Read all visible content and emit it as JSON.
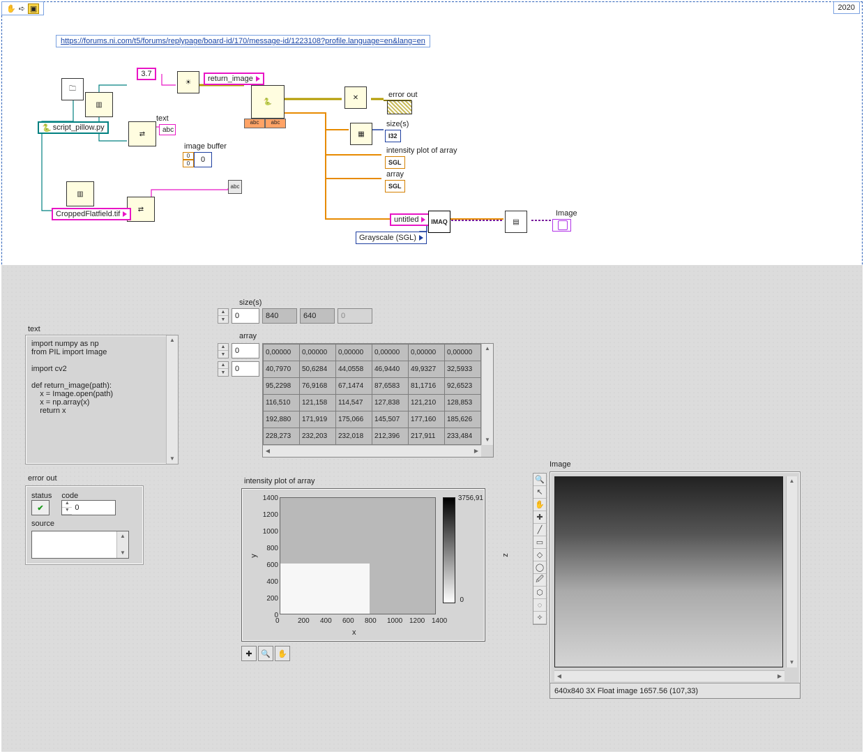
{
  "meta": {
    "year": "2020"
  },
  "link": "https://forums.ni.com/t5/forums/replypage/board-id/170/message-id/1223108?profile.language=en&lang=en",
  "bd": {
    "brightness_const": "3.7",
    "script_path": "script_pillow.py",
    "flatfield_path": "CroppedFlatfield.tif",
    "return_image_label": "return_image",
    "text_label": "text",
    "image_buffer_label": "image buffer",
    "error_out_label": "error out",
    "sizes_label": "size(s)",
    "intensity_label": "intensity plot of array",
    "array_label": "array",
    "untitled_label": "untitled",
    "image_out_label": "Image",
    "ring_grayscale": "Grayscale (SGL)",
    "sizes_type": "I32",
    "sgl_type": "SGL",
    "imaq_label": "IMAQ"
  },
  "fp": {
    "text": {
      "label": "text",
      "body": "import numpy as np\nfrom PIL import Image\n\nimport cv2\n\ndef return_image(path):\n    x = Image.open(path)\n    x = np.array(x)\n    return x"
    },
    "sizes": {
      "label": "size(s)",
      "index": "0",
      "values": [
        "840",
        "640",
        "0"
      ]
    },
    "array": {
      "label": "array",
      "row_idx": "0",
      "col_idx": "0",
      "rows": [
        [
          "0,00000",
          "0,00000",
          "0,00000",
          "0,00000",
          "0,00000",
          "0,00000"
        ],
        [
          "40,7970",
          "50,6284",
          "44,0558",
          "46,9440",
          "49,9327",
          "32,5933"
        ],
        [
          "95,2298",
          "76,9168",
          "67,1474",
          "87,6583",
          "81,1716",
          "92,6523"
        ],
        [
          "116,510",
          "121,158",
          "114,547",
          "127,838",
          "121,210",
          "128,853"
        ],
        [
          "192,880",
          "171,919",
          "175,066",
          "145,507",
          "177,160",
          "185,626"
        ],
        [
          "228,273",
          "232,203",
          "232,018",
          "212,396",
          "217,911",
          "233,484"
        ]
      ]
    },
    "error": {
      "label": "error out",
      "status_label": "status",
      "code_label": "code",
      "code_value": "0",
      "source_label": "source"
    },
    "intensity": {
      "label": "intensity plot of array",
      "yticks": [
        "1400",
        "1200",
        "1000",
        "800",
        "600",
        "400",
        "200",
        "0"
      ],
      "xticks": [
        "0",
        "200",
        "400",
        "600",
        "800",
        "1000",
        "1200",
        "1400"
      ],
      "xlabel": "x",
      "ylabel": "y",
      "zlabel": "z",
      "zmax": "3756,91",
      "zmin": "0"
    },
    "image": {
      "label": "Image",
      "status": "640x840 3X Float image 1657.56    (107,33)"
    }
  }
}
